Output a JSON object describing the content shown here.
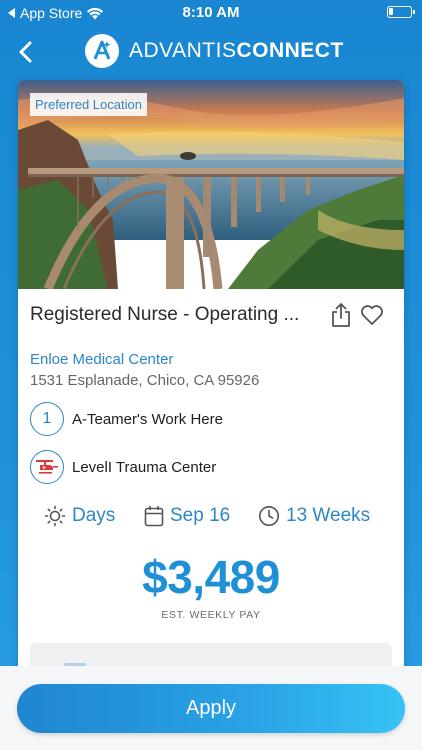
{
  "status_bar": {
    "back_app": "App Store",
    "time": "8:10 AM"
  },
  "nav": {
    "brand_light": "ADVANTIS",
    "brand_bold": "CONNECT"
  },
  "job": {
    "badge": "Preferred Location",
    "title": "Registered Nurse - Operating ...",
    "facility": "Enloe Medical Center",
    "address": "1531 Esplanade, Chico, CA  95926",
    "features": [
      {
        "icon_text": "1",
        "label": "A-Teamer's Work Here"
      },
      {
        "icon_text": "",
        "label": "LevelI Trauma Center"
      }
    ],
    "meta": {
      "shift": "Days",
      "start_date": "Sep 16",
      "duration": "13 Weeks"
    },
    "pay": "$3,489",
    "pay_label": "EST. WEEKLY PAY"
  },
  "actions": {
    "apply_label": "Apply"
  },
  "colors": {
    "accent": "#1f8fd6",
    "link": "#2c86c8",
    "trauma_red": "#d93a3a"
  }
}
